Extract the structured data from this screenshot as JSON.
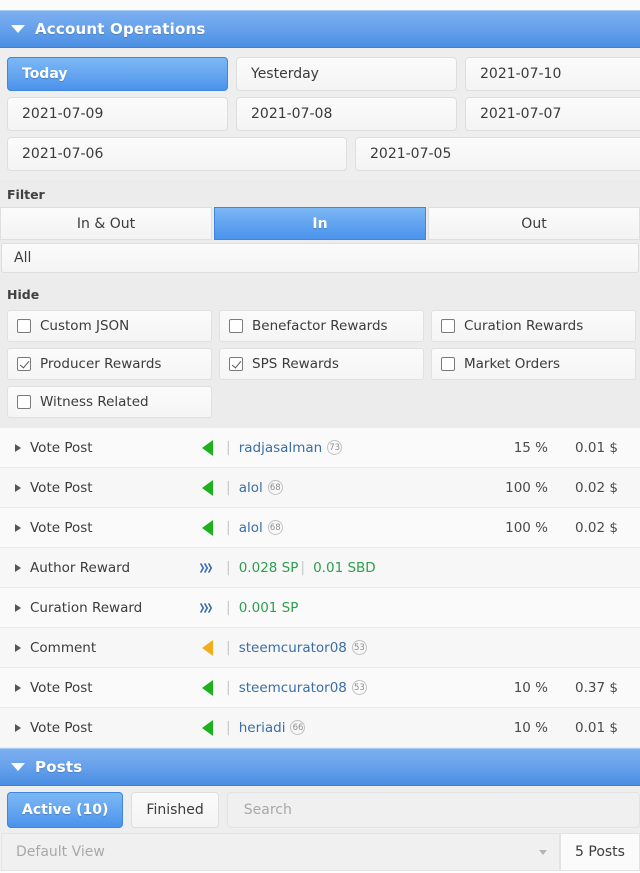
{
  "accounts_section": {
    "title": "Account Operations",
    "caret_icon": "caret-down-icon",
    "dates": [
      [
        "Today",
        "Yesterday",
        "2021-07-10"
      ],
      [
        "2021-07-09",
        "2021-07-08",
        "2021-07-07"
      ],
      [
        "2021-07-06",
        "2021-07-05"
      ]
    ],
    "active_date": "Today"
  },
  "filter": {
    "label": "Filter",
    "segments": [
      {
        "label": "In & Out",
        "active": false
      },
      {
        "label": "In",
        "active": true
      },
      {
        "label": "Out",
        "active": false
      }
    ],
    "all_label": "All"
  },
  "hide": {
    "label": "Hide",
    "items": [
      {
        "label": "Custom JSON",
        "checked": false
      },
      {
        "label": "Benefactor Rewards",
        "checked": false
      },
      {
        "label": "Curation Rewards",
        "checked": false
      },
      {
        "label": "Producer Rewards",
        "checked": true
      },
      {
        "label": "SPS Rewards",
        "checked": true
      },
      {
        "label": "Market Orders",
        "checked": false
      },
      {
        "label": "Witness Related",
        "checked": false
      }
    ]
  },
  "operations": [
    {
      "type": "Vote Post",
      "icon": "vote-triangle-green-icon",
      "user": "radjasalman",
      "rep": "73",
      "pct": "15 %",
      "value": "0.01 $"
    },
    {
      "type": "Vote Post",
      "icon": "vote-triangle-green-icon",
      "user": "alol",
      "rep": "68",
      "pct": "100 %",
      "value": "0.02 $"
    },
    {
      "type": "Vote Post",
      "icon": "vote-triangle-green-icon",
      "user": "alol",
      "rep": "68",
      "pct": "100 %",
      "value": "0.02 $"
    },
    {
      "type": "Author Reward",
      "icon": "steem-logo-icon",
      "amounts": [
        "0.028 SP",
        "0.01 SBD"
      ],
      "pct": "",
      "value": ""
    },
    {
      "type": "Curation Reward",
      "icon": "steem-logo-icon",
      "amounts": [
        "0.001 SP"
      ],
      "pct": "",
      "value": ""
    },
    {
      "type": "Comment",
      "icon": "comment-triangle-orange-icon",
      "user": "steemcurator08",
      "rep": "53",
      "pct": "",
      "value": ""
    },
    {
      "type": "Vote Post",
      "icon": "vote-triangle-green-icon",
      "user": "steemcurator08",
      "rep": "53",
      "pct": "10 %",
      "value": "0.37 $"
    },
    {
      "type": "Vote Post",
      "icon": "vote-triangle-green-icon",
      "user": "heriadi",
      "rep": "66",
      "pct": "10 %",
      "value": "0.01 $"
    }
  ],
  "posts_section": {
    "title": "Posts",
    "caret_icon": "caret-down-icon",
    "tab_active": "Active (10)",
    "tab_finished": "Finished",
    "search_placeholder": "Search",
    "view_placeholder": "Default View",
    "posts_count": "5 Posts"
  },
  "colors": {
    "accent_blue": "#4a93ec",
    "header_blue_top": "#7cb0f0",
    "vote_green": "#1db11d",
    "comment_orange": "#f0ad20",
    "amount_green": "#2e9e4f",
    "user_link": "#3a6ea5"
  }
}
